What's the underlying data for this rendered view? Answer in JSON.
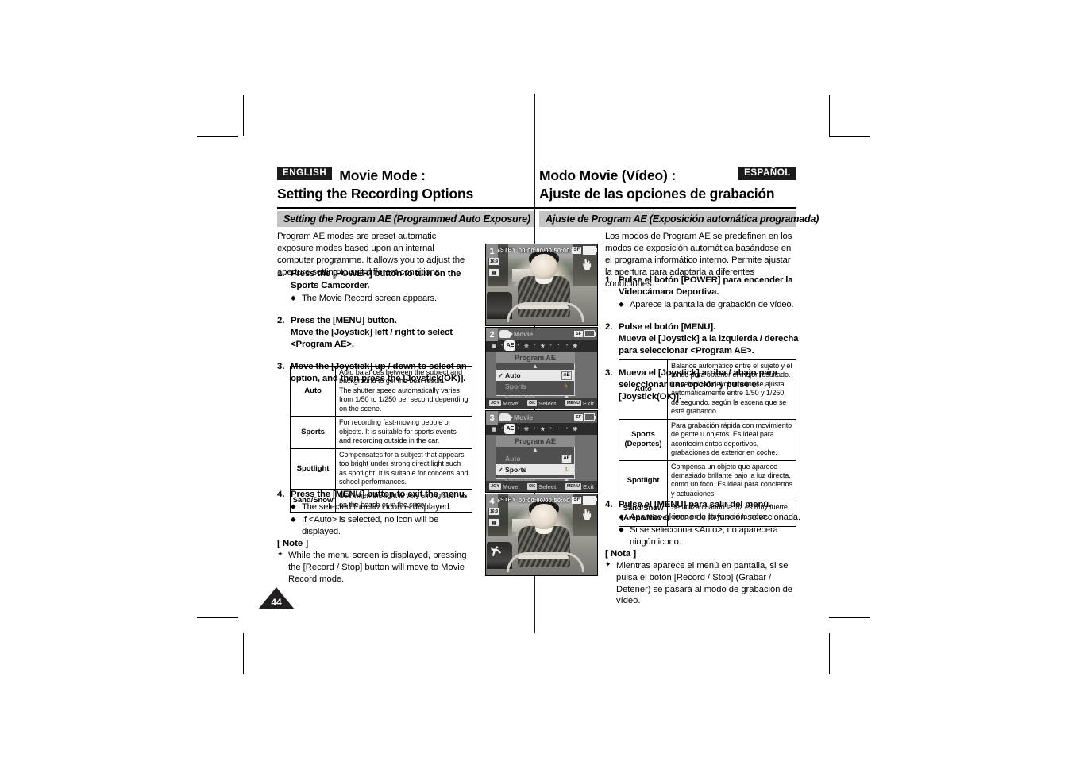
{
  "page": {
    "number": "44"
  },
  "english": {
    "lang_tag": "ENGLISH",
    "title_line1": "Movie Mode :",
    "title_line2": "Setting the Recording Options",
    "section_bar": "Setting the Program AE (Programmed Auto Exposure)",
    "intro": "Program AE modes are preset automatic exposure modes based upon an internal computer programme. It allows you to adjust the aperture setting to suit different conditions.",
    "steps": [
      {
        "num": "1.",
        "text": "Press the [POWER] button to turn on the Sports Camcorder.",
        "bullets": [
          "The Movie Record screen appears."
        ]
      },
      {
        "num": "2.",
        "text": "Press the [MENU] button.\nMove the [Joystick] left / right to select <Program AE>.",
        "bullets": []
      },
      {
        "num": "3.",
        "text": "Move the [Joystick] up / down to select an option, and then press the [Joystick(OK)].",
        "bullets": []
      },
      {
        "num": "4.",
        "text": "Press the [MENU] button to exit the menu.",
        "bullets": [
          "The selected function icon is displayed.",
          "If <Auto> is selected, no icon will be displayed."
        ]
      }
    ],
    "table": {
      "rows": [
        {
          "name": "Auto",
          "desc": "Auto balances between the subject and background to get the best result.\nThe shutter speed automatically varies from 1/50 to 1/250 per second depending on the scene."
        },
        {
          "name": "Sports",
          "desc": "For recording fast-moving people or objects. It is suitable for sports events and recording outside in the car."
        },
        {
          "name": "Spotlight",
          "desc": "Compensates for a subject that appears too bright under strong direct light such as spotlight. It is suitable for concerts and school performances."
        },
        {
          "name": "Sand/Snow",
          "desc": "Use when the light is very strong such as on the beach or in the snow."
        }
      ]
    },
    "note": {
      "title": "[ Note ]",
      "items": [
        "While the menu screen is displayed, pressing the [Record / Stop] button will move to Movie Record mode."
      ]
    }
  },
  "spanish": {
    "lang_tag": "ESPAÑOL",
    "title_line1": "Modo Movie (Vídeo) :",
    "title_line2": "Ajuste de las opciones de grabación",
    "section_bar": "Ajuste de Program AE (Exposición automática programada)",
    "intro": "Los modos de Program AE se predefinen en los modos de exposición automática basándose en el programa informático interno. Permite ajustar la apertura para adaptarla a diferentes condiciones.",
    "steps": [
      {
        "num": "1.",
        "text": "Pulse el botón [POWER] para encender la Videocámara Deportiva.",
        "bullets": [
          "Aparece la pantalla de grabación de vídeo."
        ]
      },
      {
        "num": "2.",
        "text": "Pulse el botón [MENU].\nMueva el [Joystick] a la izquierda / derecha para seleccionar <Program AE>.",
        "bullets": []
      },
      {
        "num": "3.",
        "text": "Mueva el [Joystick] arriba / abajo para seleccionar una opción y pulse el [Joystick(OK)].",
        "bullets": []
      },
      {
        "num": "4.",
        "text": "Pulse el [MENU] para salir del menú.",
        "bullets": [
          "Aparece el icono de la función seleccionada.",
          "Si se selecciona <Auto>, no aparecerá ningún icono."
        ]
      }
    ],
    "table": {
      "rows": [
        {
          "name": "Auto",
          "desc": "Balance automático entre el sujeto y el fondo para obtener el mejor resultado.\nLa velocidad del obturador se ajusta automáticamente entre 1/50 y 1/250 de segundo, según la escena que se esté grabando."
        },
        {
          "name": "Sports\n(Deportes)",
          "desc": "Para grabación rápida con movimiento de gente u objetos. Es ideal para acontecimientos deportivos, grabaciones de exterior en coche."
        },
        {
          "name": "Spotlight",
          "desc": "Compensa un objeto que aparece demasiado brillante bajo la luz directa, como un foco. Es ideal para conciertos y actuaciones."
        },
        {
          "name": "Sand/Snow\n(Arena/Nieve)",
          "desc": "Se utiliza cuando la luz es muy fuerte, como en la playa o en la nieve."
        }
      ]
    },
    "note": {
      "title": "[ Nota ]",
      "items": [
        "Mientras aparece el menú en pantalla, si se pulsa el botón [Record / Stop] (Grabar / Detener) se pasará al modo de grabación de vídeo."
      ]
    }
  },
  "screens": [
    {
      "tag": "1",
      "kind": "record",
      "osd": {
        "status": "STBY",
        "timecode": "00:00:00/00:50:00",
        "quality_chip": "SF",
        "left_icons": [
          "16:9",
          "widescreen"
        ],
        "hand_icon": "hand-icon"
      }
    },
    {
      "tag": "2",
      "kind": "menu",
      "title": "Movie",
      "submenu": "Program AE",
      "tab_selected": "AE",
      "options": [
        {
          "label": "Auto",
          "selected": true,
          "icon": "AE-auto-icon"
        },
        {
          "label": "Sports",
          "selected": false,
          "icon": "sports-runner-icon"
        },
        {
          "label": "Spotlight",
          "selected": false,
          "icon": "spotlight-icon"
        }
      ],
      "footer": [
        {
          "key": "JOY",
          "label": "Move"
        },
        {
          "key": "OK",
          "label": "Select"
        },
        {
          "key": "MENU",
          "label": "Exit"
        }
      ]
    },
    {
      "tag": "3",
      "kind": "menu",
      "title": "Movie",
      "submenu": "Program AE",
      "tab_selected": "AE",
      "options": [
        {
          "label": "Auto",
          "selected": false,
          "icon": "AE-auto-icon"
        },
        {
          "label": "Sports",
          "selected": true,
          "icon": "sports-runner-icon"
        },
        {
          "label": "Spotlight",
          "selected": false,
          "icon": "spotlight-icon"
        }
      ],
      "footer": [
        {
          "key": "JOY",
          "label": "Move"
        },
        {
          "key": "OK",
          "label": "Select"
        },
        {
          "key": "MENU",
          "label": "Exit"
        }
      ]
    },
    {
      "tag": "4",
      "kind": "record",
      "osd": {
        "status": "STBY",
        "timecode": "00:00:00/00:50:00",
        "quality_chip": "SF",
        "left_icons": [
          "16:9",
          "widescreen"
        ],
        "hand_icon": "hand-icon",
        "mode_icon": "sports-runner-icon"
      }
    }
  ]
}
